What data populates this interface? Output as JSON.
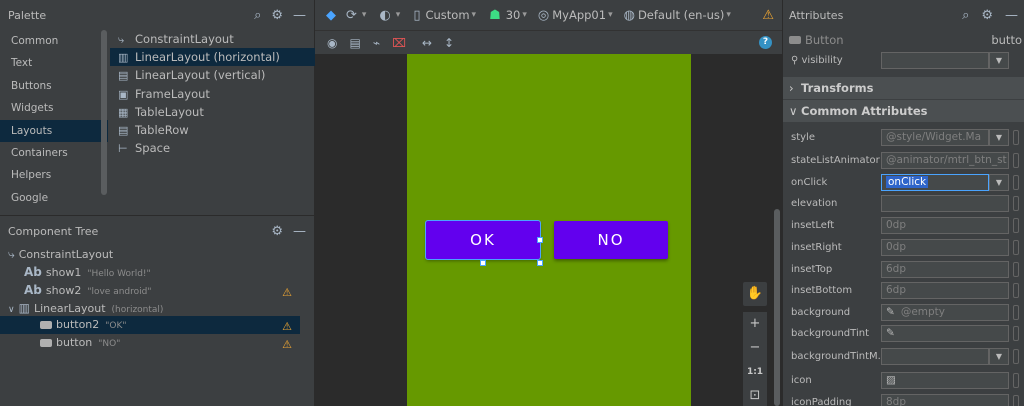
{
  "palette": {
    "title": "Palette",
    "categories": [
      "Common",
      "Text",
      "Buttons",
      "Widgets",
      "Layouts",
      "Containers",
      "Helpers",
      "Google"
    ],
    "items": [
      {
        "label": "ConstraintLayout",
        "icon": "constraint-icon",
        "glyph": "⤷"
      },
      {
        "label": "LinearLayout (horizontal)",
        "icon": "linear-horizontal-icon",
        "glyph": "▥"
      },
      {
        "label": "LinearLayout (vertical)",
        "icon": "linear-vertical-icon",
        "glyph": "▤"
      },
      {
        "label": "FrameLayout",
        "icon": "frame-icon",
        "glyph": "▣"
      },
      {
        "label": "TableLayout",
        "icon": "table-icon",
        "glyph": "▦"
      },
      {
        "label": "TableRow",
        "icon": "tablerow-icon",
        "glyph": "▤"
      },
      {
        "label": "Space",
        "icon": "space-icon",
        "glyph": "⊢"
      }
    ]
  },
  "component_tree": {
    "title": "Component Tree",
    "nodes": [
      {
        "label": "ConstraintLayout",
        "sub": "",
        "icon": "constraint-icon",
        "prefix": "⤷"
      },
      {
        "label": "show1",
        "sub": "\"Hello World!\"",
        "icon": "textview-icon",
        "prefix": "Ab"
      },
      {
        "label": "show2",
        "sub": "\"love android\"",
        "icon": "textview-icon",
        "prefix": "Ab"
      },
      {
        "label": "LinearLayout",
        "sub": "(horizontal)",
        "icon": "linear-horizontal-icon",
        "prefix": "▥"
      },
      {
        "label": "button2",
        "sub": "\"OK\"",
        "icon": "button-icon",
        "prefix": ""
      },
      {
        "label": "button",
        "sub": "\"NO\"",
        "icon": "button-icon",
        "prefix": ""
      }
    ]
  },
  "toolbar": {
    "device": "Custom",
    "api": "30",
    "app": "MyApp01",
    "locale": "Default (en-us)"
  },
  "design": {
    "buttons": [
      {
        "label": "OK"
      },
      {
        "label": "NO"
      }
    ],
    "zoom_fit": "1:1",
    "colors": {
      "background": "#669900",
      "button": "#6200ee",
      "selection": "#4aa4ff"
    }
  },
  "attributes": {
    "title": "Attributes",
    "component": "Button",
    "component_id": "butto",
    "visibility_label": "visibility",
    "sections": [
      "Transforms",
      "Common Attributes"
    ],
    "rows": [
      {
        "label": "style",
        "value": "@style/Widget.Ma"
      },
      {
        "label": "stateListAnimator",
        "value": "@animator/mtrl_btn_st"
      },
      {
        "label": "onClick",
        "value": "onClick"
      },
      {
        "label": "elevation",
        "value": ""
      },
      {
        "label": "insetLeft",
        "value": "0dp"
      },
      {
        "label": "insetRight",
        "value": "0dp"
      },
      {
        "label": "insetTop",
        "value": "6dp"
      },
      {
        "label": "insetBottom",
        "value": "6dp"
      },
      {
        "label": "background",
        "value": "@empty"
      },
      {
        "label": "backgroundTint",
        "value": ""
      },
      {
        "label": "backgroundTintM...",
        "value": ""
      },
      {
        "label": "icon",
        "value": ""
      },
      {
        "label": "iconPadding",
        "value": "8dp"
      }
    ]
  }
}
